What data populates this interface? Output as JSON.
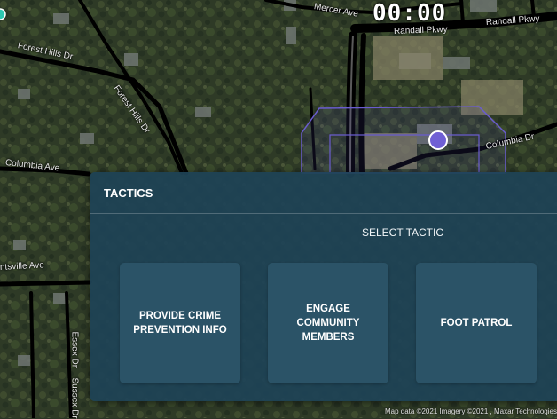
{
  "clock": "00:00",
  "map": {
    "street_labels": [
      "Forest Hills Dr",
      "Forest Hills Dr",
      "Columbia Ave",
      "Randall Pkwy",
      "Randall Pkwy",
      "Mercer Ave",
      "Columbia Dr",
      "ntsville Ave",
      "Essex Dr",
      "Sussex Dr"
    ],
    "attribution": "Map data ©2021 Imagery ©2021 , Maxar Technologies",
    "marker_color": "#6f5fd4",
    "zone_color": "#6a5ccf"
  },
  "panel": {
    "title": "TACTICS",
    "subtitle": "SELECT TACTIC",
    "tactics": [
      {
        "label": "PROVIDE CRIME PREVENTION INFO"
      },
      {
        "label": "ENGAGE COMMUNITY MEMBERS"
      },
      {
        "label": "FOOT PATROL"
      }
    ]
  }
}
